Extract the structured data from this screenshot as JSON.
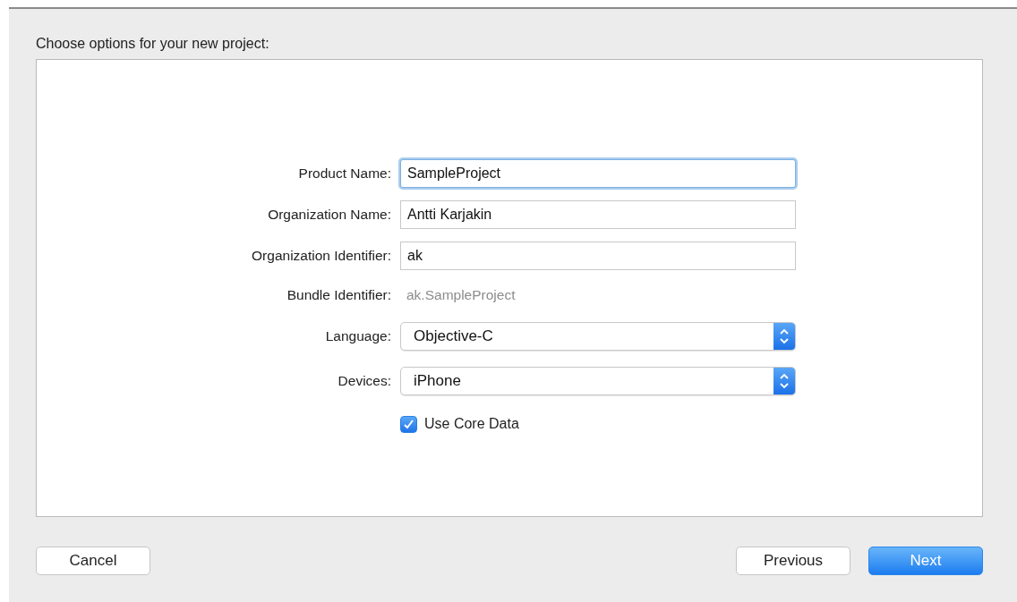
{
  "sheet": {
    "title": "Choose options for your new project:"
  },
  "form": [
    {
      "kind": "text",
      "label": "Product Name:",
      "value": "SampleProject",
      "focused": true
    },
    {
      "kind": "text",
      "label": "Organization Name:",
      "value": "Antti Karjakin",
      "focused": false
    },
    {
      "kind": "text",
      "label": "Organization Identifier:",
      "value": "ak",
      "focused": false
    },
    {
      "kind": "static",
      "label": "Bundle Identifier:",
      "value": "ak.SampleProject"
    },
    {
      "kind": "popup",
      "label": "Language:",
      "value": "Objective-C"
    },
    {
      "kind": "popup",
      "label": "Devices:",
      "value": "iPhone"
    },
    {
      "kind": "checkbox",
      "label": "Use Core Data",
      "checked": true
    }
  ],
  "buttons": [
    {
      "label": "Cancel",
      "kind": "left",
      "default": false
    },
    {
      "label": "Previous",
      "kind": "right",
      "default": false
    },
    {
      "label": "Next",
      "kind": "right",
      "default": true
    }
  ]
}
